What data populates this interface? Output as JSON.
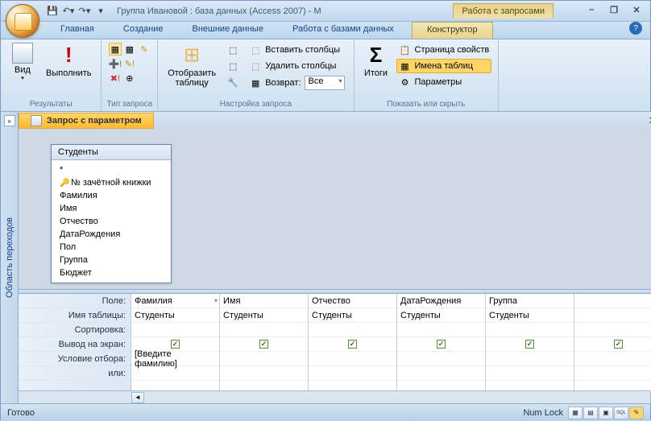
{
  "title": "Группа Ивановой : база данных (Access 2007) - M",
  "contextTabGroup": "Работа с запросами",
  "tabs": {
    "home": "Главная",
    "create": "Создание",
    "external": "Внешние данные",
    "dbtools": "Работа с базами данных",
    "design": "Конструктор"
  },
  "ribbon": {
    "results": {
      "label": "Результаты",
      "view": "Вид",
      "run": "Выполнить"
    },
    "qtype": {
      "label": "Тип запроса"
    },
    "setup": {
      "label": "Настройка запроса",
      "showtable": "Отобразить таблицу",
      "insertcols": "Вставить столбцы",
      "deletecols": "Удалить столбцы",
      "return": "Возврат:",
      "returnval": "Все"
    },
    "totals": "Итоги",
    "showhide": {
      "label": "Показать или скрыть",
      "props": "Страница свойств",
      "tablenames": "Имена таблиц",
      "params": "Параметры"
    }
  },
  "navpane": "Область переходов",
  "docTab": "Запрос с параметром",
  "tableWidget": {
    "title": "Студенты",
    "fields": [
      "*",
      "№ зачётной книжки",
      "Фамилия",
      "Имя",
      "Отчество",
      "ДатаРождения",
      "Пол",
      "Группа",
      "Бюджет"
    ]
  },
  "gridLabels": {
    "field": "Поле:",
    "table": "Имя таблицы:",
    "sort": "Сортировка:",
    "show": "Вывод на экран:",
    "criteria": "Условие отбора:",
    "or": "или:"
  },
  "gridCols": [
    {
      "field": "Фамилия",
      "table": "Студенты",
      "show": true,
      "criteria": "[Введите фамилию]"
    },
    {
      "field": "Имя",
      "table": "Студенты",
      "show": true,
      "criteria": ""
    },
    {
      "field": "Отчество",
      "table": "Студенты",
      "show": true,
      "criteria": ""
    },
    {
      "field": "ДатаРождения",
      "table": "Студенты",
      "show": true,
      "criteria": ""
    },
    {
      "field": "Группа",
      "table": "Студенты",
      "show": true,
      "criteria": ""
    },
    {
      "field": "",
      "table": "",
      "show": true,
      "criteria": ""
    }
  ],
  "status": {
    "ready": "Готово",
    "numlock": "Num Lock"
  }
}
